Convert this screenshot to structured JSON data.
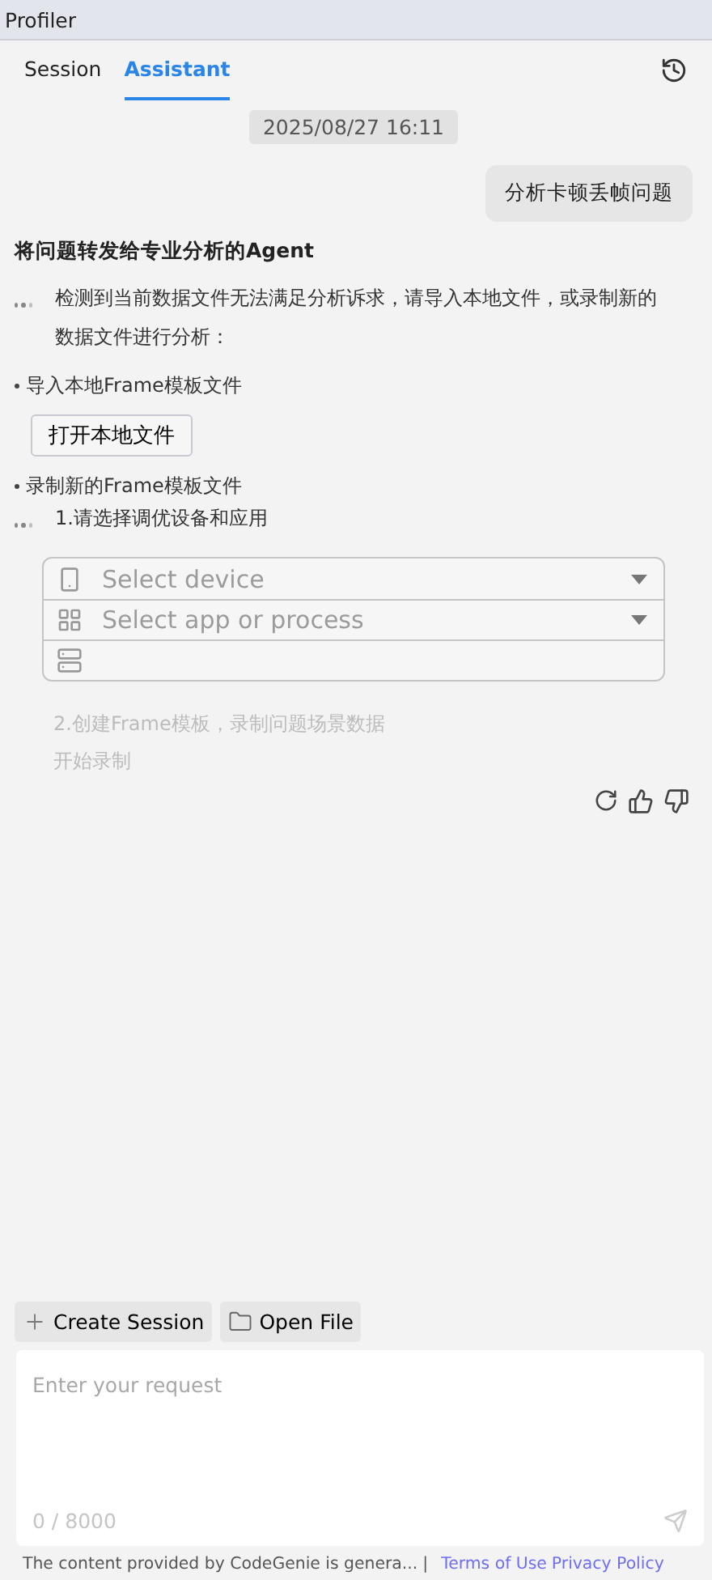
{
  "window": {
    "title": "Profiler"
  },
  "tabs": [
    {
      "label": "Session",
      "selected": false
    },
    {
      "label": "Assistant",
      "selected": true
    }
  ],
  "timestamp": "2025/08/27 16:11",
  "user_message": "分析卡顿丢帧问题",
  "reply": {
    "heading": "将问题转发给专业分析的Agent",
    "intro": [
      "检测到当前数据文件无法满足分析诉求，请导入本地文件，或录制新的",
      "数据文件进行分析："
    ],
    "import_title": "导入本地Frame模板文件",
    "open_button": "打开本地文件",
    "record_title": "录制新的Frame模板文件",
    "step_1": "1.请选择调优设备和应用",
    "selects": [
      {
        "kind": "device",
        "placeholder": "Select device"
      },
      {
        "kind": "app",
        "placeholder": "Select app or process"
      },
      {
        "kind": "template"
      }
    ],
    "step_2": {
      "lines": [
        "2.创建Frame模板，录制问题场景数据",
        "开始录制"
      ],
      "disabled": true
    }
  },
  "toolbar": [
    "Create Session",
    "Open File"
  ],
  "input": {
    "placeholder": "Enter your request",
    "counter": "0 / 8000"
  },
  "footer": {
    "notice": "The content provided by CodeGenie is genera...",
    "separator": "|",
    "links": [
      "Terms of Use",
      "Privacy Policy"
    ]
  }
}
